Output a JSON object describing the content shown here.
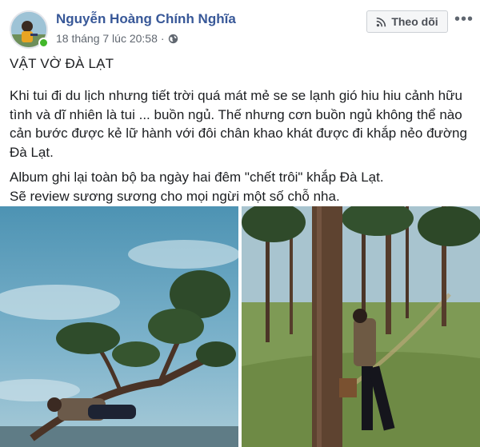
{
  "post": {
    "author": "Nguyễn Hoàng Chính Nghĩa",
    "timestamp": "18 tháng 7 lúc 20:58",
    "separator": "·",
    "privacy_icon": "globe-icon",
    "follow_label": "Theo dõi",
    "follow_icon": "rss-icon",
    "more_label": "•••",
    "title": "VẬT VỜ ĐÀ LẠT",
    "paragraph1": "Khi tui đi du lịch nhưng tiết trời quá mát mẻ se se lạnh gió hiu hiu cảnh hữu tình và dĩ nhiên là tui ... buồn ngủ. Thế nhưng cơn buồn ngủ không thể nào cản bước được kẻ lữ hành với đôi chân khao khát được đi khắp nẻo đường Đà Lạt.",
    "paragraph2_line1": "Album ghi lại toàn bộ ba ngày hai đêm \"chết trôi\" khắp Đà Lạt.",
    "paragraph2_line2": "Sẽ review sương sương cho mọi ngừi một số chỗ nha."
  },
  "colors": {
    "author_link": "#385898",
    "meta_text": "#606770",
    "online": "#42b72a",
    "button_bg": "#f5f6f7"
  }
}
